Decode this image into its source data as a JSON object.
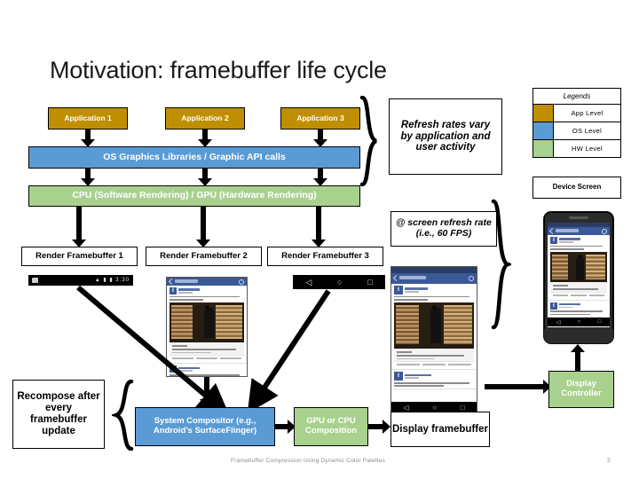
{
  "slide": {
    "title": "Motivation: framebuffer life cycle",
    "footer_text": "Framebuffer Compression Using Dynamic Color Palettes",
    "page_number": "2"
  },
  "colors": {
    "app_level": "#BF8F00",
    "os_level": "#5B9BD5",
    "hw_level": "#A9D18E",
    "outline": "#000000",
    "background": "#FFFFFF"
  },
  "applications": [
    {
      "label": "Application 1"
    },
    {
      "label": "Application 2"
    },
    {
      "label": "Application 3"
    }
  ],
  "layers": {
    "os_graphics": "OS Graphics Libraries / Graphic API calls",
    "cpu_gpu": "CPU (Software Rendering) / GPU (Hardware Rendering)"
  },
  "render_framebuffers": [
    {
      "label": "Render Framebuffer 1"
    },
    {
      "label": "Render Framebuffer 2"
    },
    {
      "label": "Render Framebuffer 3"
    }
  ],
  "notes": {
    "refresh_rates": "Refresh rates vary by application and user activity",
    "screen_refresh": "@ screen refresh rate (i.e., 60 FPS)",
    "recompose": "Recompose after every framebuffer update"
  },
  "legend": {
    "title": "Legends",
    "items": [
      {
        "label": "App Level",
        "color": "#BF8F00"
      },
      {
        "label": "OS Level",
        "color": "#5B9BD5"
      },
      {
        "label": "HW Level",
        "color": "#A9D18E"
      }
    ]
  },
  "device_screen": {
    "label": "Device Screen"
  },
  "pipeline": {
    "compositor": "System Compositor (e.g., Android’s SurfaceFlinger)",
    "composition": "GPU or CPU Composition",
    "display_framebuffer": "Display framebuffer",
    "display_controller": "Display Controller"
  },
  "icons": {
    "back": "◁",
    "home": "○",
    "recents": "□",
    "status_right": "▲ ▮ ▮ 3:30",
    "facebook_avatar": "f"
  }
}
